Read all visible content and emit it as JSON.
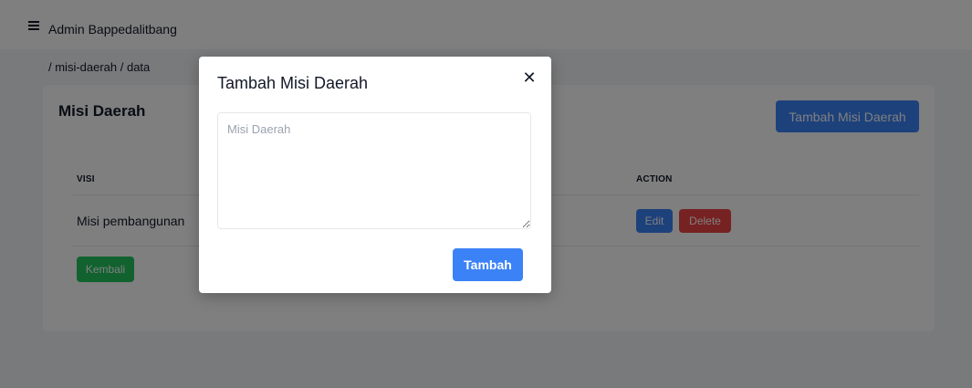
{
  "header": {
    "menu_icon": "hamburger-menu-icon",
    "app_title": "Admin Bappedalitbang"
  },
  "breadcrumb": "/ misi-daerah / data",
  "card": {
    "title": "Misi Daerah",
    "add_button_label": "Tambah Misi Daerah",
    "table": {
      "columns": [
        "VISI",
        "ACTION"
      ],
      "rows": [
        {
          "visi": "Misi pembangunan",
          "actions": [
            "Edit",
            "Delete"
          ]
        }
      ]
    },
    "back_button_label": "Kembali"
  },
  "modal": {
    "title": "Tambah Misi Daerah",
    "close_icon": "close-icon",
    "textarea": {
      "placeholder": "Misi Daerah",
      "value": ""
    },
    "submit_label": "Tambah"
  },
  "colors": {
    "primary": "#3b82f6",
    "danger": "#ef4444",
    "success": "#22c55e",
    "overlay": "rgba(0,0,0,0.5)"
  }
}
